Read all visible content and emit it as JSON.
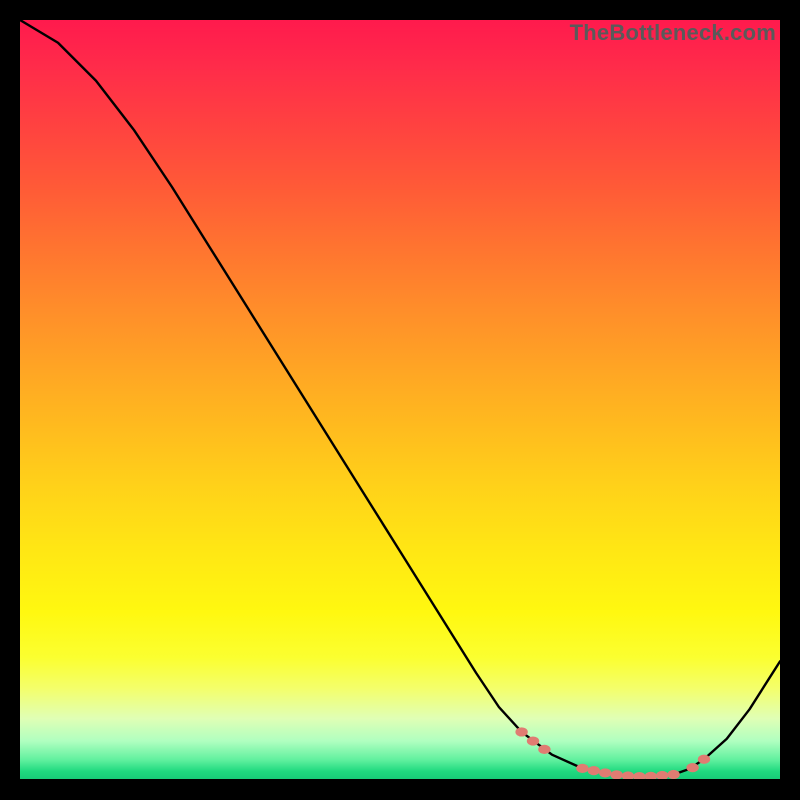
{
  "watermark": "TheBottleneck.com",
  "colors": {
    "curve_stroke": "#000000",
    "marker_fill": "#e07c72",
    "marker_stroke": "#e07c72"
  },
  "chart_data": {
    "type": "line",
    "title": "",
    "xlabel": "",
    "ylabel": "",
    "xlim": [
      0,
      100
    ],
    "ylim": [
      0,
      100
    ],
    "grid": false,
    "legend": false,
    "series": [
      {
        "name": "bottleneck-curve",
        "x": [
          0,
          5,
          10,
          15,
          20,
          25,
          30,
          35,
          40,
          45,
          50,
          55,
          60,
          63,
          66,
          70,
          74,
          78,
          82,
          86,
          88,
          90,
          93,
          96,
          100
        ],
        "y": [
          100,
          97,
          92,
          85.5,
          78,
          70,
          62,
          54,
          46,
          38,
          30,
          22,
          14,
          9.5,
          6.2,
          3.2,
          1.4,
          0.6,
          0.3,
          0.6,
          1.3,
          2.6,
          5.3,
          9.2,
          15.5
        ]
      }
    ],
    "markers": {
      "name": "highlight-band",
      "points": [
        {
          "x": 66.0,
          "y": 6.2
        },
        {
          "x": 67.5,
          "y": 5.0
        },
        {
          "x": 69.0,
          "y": 3.9
        },
        {
          "x": 74.0,
          "y": 1.4
        },
        {
          "x": 75.5,
          "y": 1.1
        },
        {
          "x": 77.0,
          "y": 0.8
        },
        {
          "x": 78.5,
          "y": 0.55
        },
        {
          "x": 80.0,
          "y": 0.4
        },
        {
          "x": 81.5,
          "y": 0.32
        },
        {
          "x": 83.0,
          "y": 0.35
        },
        {
          "x": 84.5,
          "y": 0.46
        },
        {
          "x": 86.0,
          "y": 0.6
        },
        {
          "x": 88.5,
          "y": 1.5
        },
        {
          "x": 90.0,
          "y": 2.6
        }
      ]
    }
  }
}
